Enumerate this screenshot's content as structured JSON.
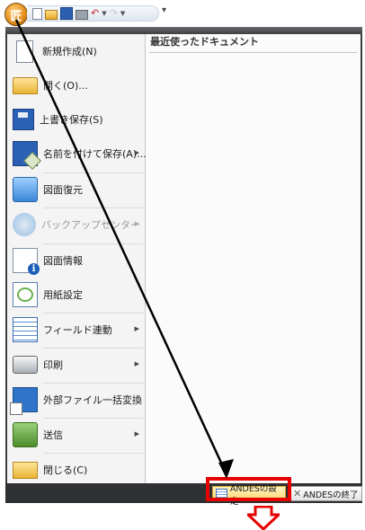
{
  "qat": {
    "app_button_glyph": "匠",
    "tools": [
      "new-icon",
      "open-icon",
      "save-icon",
      "print-icon",
      "undo-icon",
      "redo-icon"
    ],
    "customize_glyph": "▾"
  },
  "recent": {
    "header": "最近使ったドキュメント"
  },
  "menu_items": [
    {
      "label": "新規作成(N)"
    },
    {
      "label": "開く(O)..."
    },
    {
      "label": "上書き保存(S)"
    },
    {
      "label": "名前を付けて保存(A)..."
    },
    {
      "label": "図面復元"
    },
    {
      "label": "バックアップセンター"
    },
    {
      "label": "図面情報"
    },
    {
      "label": "用紙設定"
    },
    {
      "label": "フィールド連動"
    },
    {
      "label": "印刷"
    },
    {
      "label": "外部ファイル一括変換"
    },
    {
      "label": "送信"
    },
    {
      "label": "閉じる(C)"
    }
  ],
  "footer": {
    "settings_label": "ANDESの設定",
    "exit_label": "ANDESの終了"
  },
  "colors": {
    "highlight": "#e60000",
    "pointer": "#000000"
  }
}
